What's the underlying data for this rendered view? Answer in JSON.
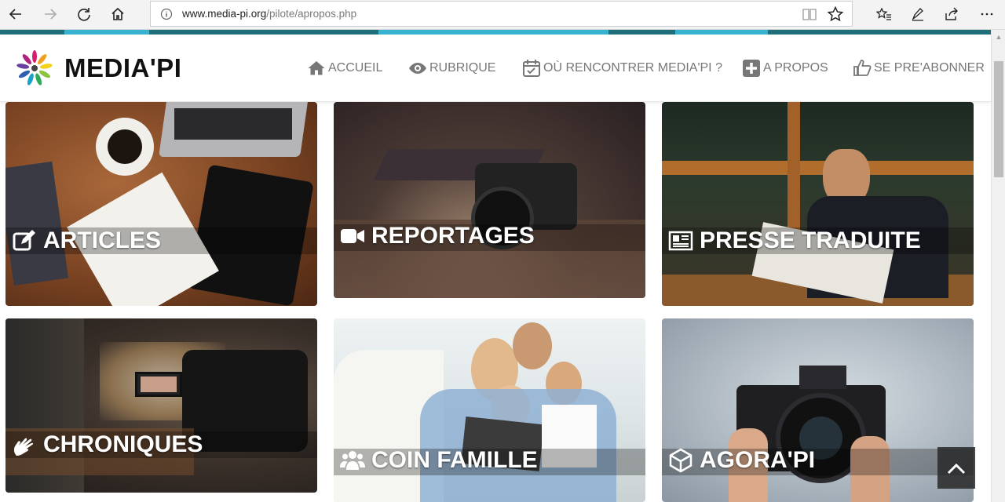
{
  "browser": {
    "url_host": "www.media-pi.org",
    "url_path": "/pilote/apropos.php"
  },
  "site": {
    "logo_text": "MEDIA'PI"
  },
  "menu": [
    {
      "label": "ACCUEIL",
      "icon": "home-icon"
    },
    {
      "label": "RUBRIQUE",
      "icon": "eye-icon"
    },
    {
      "label": "OÙ RENCONTRER MEDIA'PI ?",
      "icon": "calendar-check-icon"
    },
    {
      "label": "A PROPOS",
      "icon": "plus-square-icon"
    },
    {
      "label": "SE PRE'ABONNER",
      "icon": "thumbs-up-icon"
    }
  ],
  "tiles": [
    {
      "label": "ARTICLES",
      "icon": "edit-icon"
    },
    {
      "label": "REPORTAGES",
      "icon": "video-camera-icon"
    },
    {
      "label": "PRESSE TRADUITE",
      "icon": "newspaper-icon"
    },
    {
      "label": "CHRONIQUES",
      "icon": "sign-language-icon"
    },
    {
      "label": "COIN FAMILLE",
      "icon": "users-icon"
    },
    {
      "label": "AGORA'PI",
      "icon": "cube-icon"
    }
  ],
  "colors": {
    "accent_dark": "#1e6f7a",
    "accent_light": "#37b2cf",
    "menu_text": "#777777"
  }
}
